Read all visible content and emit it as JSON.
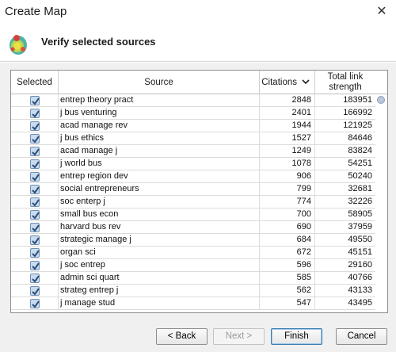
{
  "window": {
    "title": "Create Map",
    "close_icon": "close-icon"
  },
  "header": {
    "heading": "Verify selected sources",
    "logo_icon": "vosviewer-logo-icon"
  },
  "table": {
    "columns": {
      "selected": "Selected",
      "source": "Source",
      "citations": "Citations",
      "total_link_strength": "Total link strength"
    },
    "sort_icon": "chevron-down-icon",
    "rows": [
      {
        "source": "entrep theory pract",
        "citations": "2848",
        "strength": "183951",
        "checked": true
      },
      {
        "source": "j bus venturing",
        "citations": "2401",
        "strength": "166992",
        "checked": true
      },
      {
        "source": "acad manage rev",
        "citations": "1944",
        "strength": "121925",
        "checked": true
      },
      {
        "source": "j bus ethics",
        "citations": "1527",
        "strength": "84646",
        "checked": true
      },
      {
        "source": "acad manage j",
        "citations": "1249",
        "strength": "83824",
        "checked": true
      },
      {
        "source": "j world bus",
        "citations": "1078",
        "strength": "54251",
        "checked": true
      },
      {
        "source": "entrep region dev",
        "citations": "906",
        "strength": "50240",
        "checked": true
      },
      {
        "source": "social entrepreneurs",
        "citations": "799",
        "strength": "32681",
        "checked": true
      },
      {
        "source": "soc enterp j",
        "citations": "774",
        "strength": "32226",
        "checked": true
      },
      {
        "source": "small bus econ",
        "citations": "700",
        "strength": "58905",
        "checked": true
      },
      {
        "source": "harvard bus rev",
        "citations": "690",
        "strength": "37959",
        "checked": true
      },
      {
        "source": "strategic manage j",
        "citations": "684",
        "strength": "49550",
        "checked": true
      },
      {
        "source": "organ sci",
        "citations": "672",
        "strength": "45151",
        "checked": true
      },
      {
        "source": "j soc entrep",
        "citations": "596",
        "strength": "29160",
        "checked": true
      },
      {
        "source": "admin sci quart",
        "citations": "585",
        "strength": "40766",
        "checked": true
      },
      {
        "source": "strateg entrep j",
        "citations": "562",
        "strength": "43133",
        "checked": true
      },
      {
        "source": "j manage stud",
        "citations": "547",
        "strength": "43495",
        "checked": true
      }
    ]
  },
  "buttons": {
    "back": "< Back",
    "next": "Next >",
    "finish": "Finish",
    "cancel": "Cancel"
  },
  "colors": {
    "checkbox_fill": "#c9dbee",
    "checkmark": "#2a4d7a",
    "default_button_border": "#3c7fb1"
  }
}
